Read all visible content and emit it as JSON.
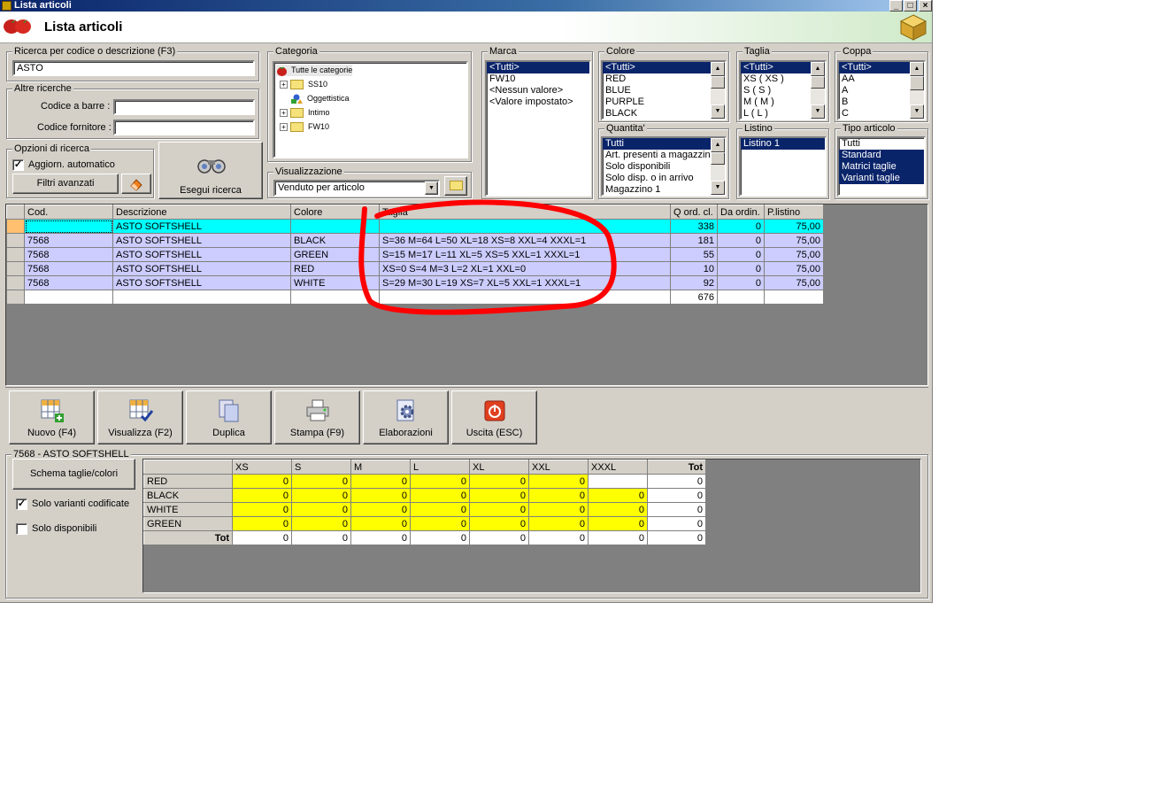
{
  "window": {
    "title": "Lista articoli",
    "header_title": "Lista articoli"
  },
  "search": {
    "group_label": "Ricerca per codice o descrizione (F3)",
    "value": "ASTO",
    "other_label": "Altre ricerche",
    "barcode_label": "Codice a barre :",
    "barcode_value": "",
    "supplier_label": "Codice fornitore :",
    "supplier_value": "",
    "options_label": "Opzioni di ricerca",
    "auto_update_label": "Aggiorn. automatico",
    "auto_update_checked": true,
    "advanced_filters_label": "Filtri avanzati",
    "run_search_label": "Esegui ricerca"
  },
  "category": {
    "label": "Categoria",
    "root": "Tutte le categorie",
    "nodes": [
      "SS10",
      "Oggettistica",
      "Intimo",
      "FW10"
    ]
  },
  "view": {
    "label": "Visualizzazione",
    "value": "Venduto per articolo"
  },
  "filters": {
    "marca": {
      "label": "Marca",
      "items": [
        "<Tutti>",
        "FW10",
        "<Nessun valore>",
        "<Valore impostato>"
      ]
    },
    "colore": {
      "label": "Colore",
      "items": [
        "<Tutti>",
        "RED",
        "BLUE",
        "PURPLE",
        "BLACK"
      ]
    },
    "taglia": {
      "label": "Taglia",
      "items": [
        "<Tutti>",
        "XS ( XS )",
        "S ( S )",
        "M ( M )",
        "L ( L )"
      ]
    },
    "coppa": {
      "label": "Coppa",
      "items": [
        "<Tutti>",
        "AA",
        "A",
        "B",
        "C"
      ]
    },
    "quantita": {
      "label": "Quantita'",
      "items": [
        "Tutti",
        "Art. presenti a magazzino",
        "Solo disponibili",
        "Solo disp. o in arrivo",
        "Magazzino 1"
      ]
    },
    "listino": {
      "label": "Listino",
      "items": [
        "Listino 1"
      ]
    },
    "tipo": {
      "label": "Tipo articolo",
      "items": [
        "Tutti",
        "Standard",
        "Matrici taglie",
        "Varianti taglie"
      ]
    }
  },
  "grid": {
    "columns": [
      "Cod.",
      "Descrizione",
      "Colore",
      "Taglia",
      "Q ord. cl.",
      "Da ordin.",
      "P.listino"
    ],
    "rows": [
      {
        "cod": "",
        "desc": "ASTO SOFTSHELL",
        "colore": "",
        "taglia": "",
        "qord": "338",
        "daord": "0",
        "prezzo": "75,00"
      },
      {
        "cod": "7568",
        "desc": "ASTO SOFTSHELL",
        "colore": "BLACK",
        "taglia": "S=36  M=64  L=50  XL=18  XS=8  XXL=4  XXXL=1",
        "qord": "181",
        "daord": "0",
        "prezzo": "75,00"
      },
      {
        "cod": "7568",
        "desc": "ASTO SOFTSHELL",
        "colore": "GREEN",
        "taglia": "S=15  M=17  L=11  XL=5  XS=5  XXL=1  XXXL=1",
        "qord": "55",
        "daord": "0",
        "prezzo": "75,00"
      },
      {
        "cod": "7568",
        "desc": "ASTO SOFTSHELL",
        "colore": "RED",
        "taglia": "XS=0  S=4  M=3  L=2  XL=1  XXL=0",
        "qord": "10",
        "daord": "0",
        "prezzo": "75,00"
      },
      {
        "cod": "7568",
        "desc": "ASTO SOFTSHELL",
        "colore": "WHITE",
        "taglia": "S=29  M=30  L=19  XS=7  XL=5  XXL=1  XXXL=1",
        "qord": "92",
        "daord": "0",
        "prezzo": "75,00"
      }
    ],
    "total": "676"
  },
  "toolbar": {
    "new": "Nuovo (F4)",
    "view": "Visualizza (F2)",
    "duplicate": "Duplica",
    "print": "Stampa (F9)",
    "process": "Elaborazioni",
    "exit": "Uscita (ESC)"
  },
  "matrix": {
    "group_label": "7568 - ASTO SOFTSHELL",
    "schema_button": "Schema taglie/colori",
    "only_coded_label": "Solo varianti codificate",
    "only_coded_checked": true,
    "only_avail_label": "Solo disponibili",
    "only_avail_checked": false,
    "sizes": [
      "XS",
      "S",
      "M",
      "L",
      "XL",
      "XXL",
      "XXXL"
    ],
    "tot_label": "Tot",
    "rows": [
      {
        "color": "RED",
        "values": [
          "0",
          "0",
          "0",
          "0",
          "0",
          "0",
          ""
        ],
        "tot": "0"
      },
      {
        "color": "BLACK",
        "values": [
          "0",
          "0",
          "0",
          "0",
          "0",
          "0",
          "0"
        ],
        "tot": "0"
      },
      {
        "color": "WHITE",
        "values": [
          "0",
          "0",
          "0",
          "0",
          "0",
          "0",
          "0"
        ],
        "tot": "0"
      },
      {
        "color": "GREEN",
        "values": [
          "0",
          "0",
          "0",
          "0",
          "0",
          "0",
          "0"
        ],
        "tot": "0"
      }
    ],
    "totals": [
      "0",
      "0",
      "0",
      "0",
      "0",
      "0",
      "0"
    ],
    "grand_total": "0"
  },
  "annotation_color": "#ff0000"
}
